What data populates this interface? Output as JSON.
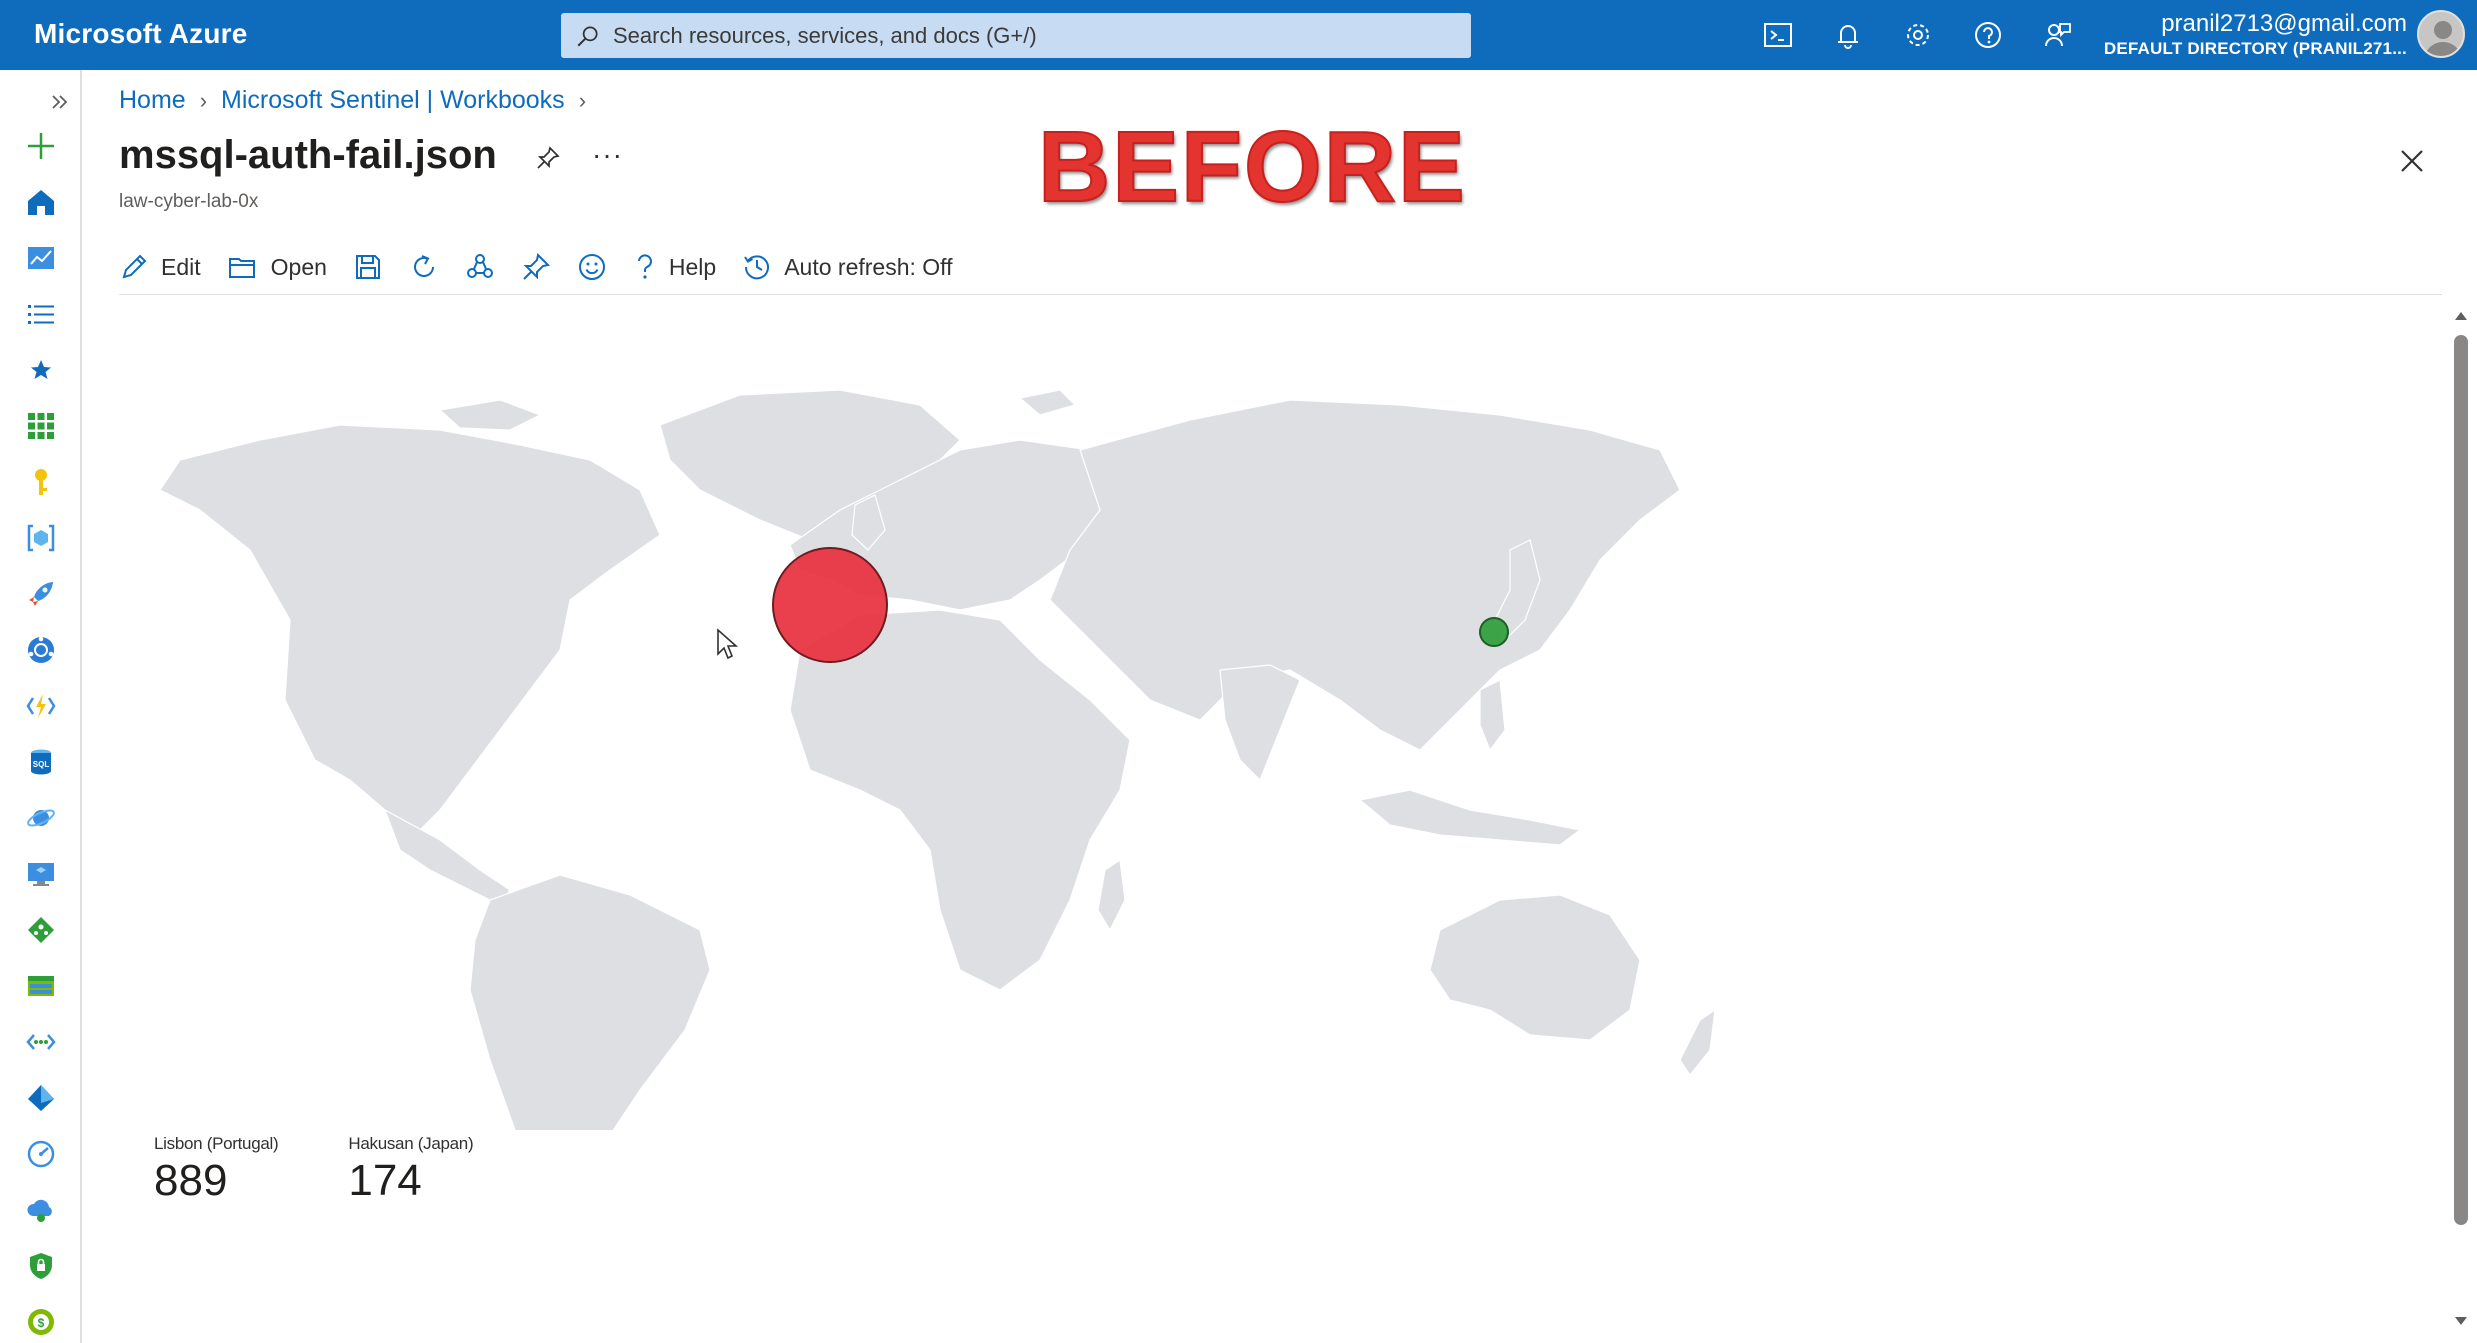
{
  "topbar": {
    "brand": "Microsoft Azure",
    "search_placeholder": "Search resources, services, and docs (G+/)",
    "icons": [
      "cloud-shell-icon",
      "bell-icon",
      "gear-icon",
      "help-icon",
      "feedback-icon"
    ],
    "account_email": "pranil2713@gmail.com",
    "account_directory": "DEFAULT DIRECTORY (PRANIL271..."
  },
  "breadcrumb": {
    "home": "Home",
    "parent": "Microsoft Sentinel | Workbooks"
  },
  "page": {
    "title": "mssql-auth-fail.json",
    "subtitle": "law-cyber-lab-0x",
    "overlay_label": "BEFORE",
    "more": "···"
  },
  "toolbar": {
    "edit": "Edit",
    "open": "Open",
    "help": "Help",
    "auto_refresh": "Auto refresh: Off"
  },
  "map": {
    "points": [
      {
        "name": "Lisbon (Portugal)",
        "value": 889,
        "color": "#e8303f"
      },
      {
        "name": "Hakusan (Japan)",
        "value": 174,
        "color": "#2e9e3a"
      }
    ]
  },
  "tiles": [
    {
      "label": "Lisbon (Portugal)",
      "value": "889"
    },
    {
      "label": "Hakusan (Japan)",
      "value": "174"
    }
  ],
  "colors": {
    "accent": "#0f6cbd",
    "land": "#dedfe2",
    "overlay_red": "#e3342f"
  }
}
